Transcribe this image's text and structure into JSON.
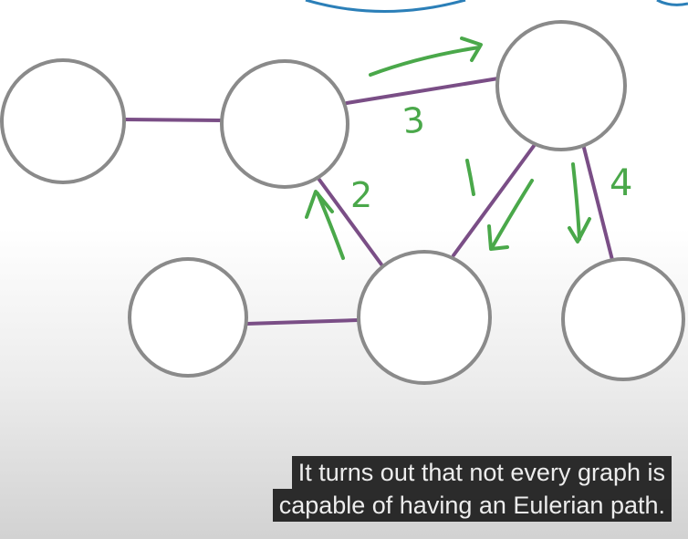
{
  "graph": {
    "labels": [
      "3",
      "2",
      "1",
      "4"
    ]
  },
  "caption": {
    "line1": "It turns out that not every graph is",
    "line2": "capable of having an Eulerian path."
  },
  "colors": {
    "node_stroke": "#8a8a8a",
    "edge": "#7a4e86",
    "annotation": "#4aa84a",
    "top_curve": "#2b7fb8"
  }
}
